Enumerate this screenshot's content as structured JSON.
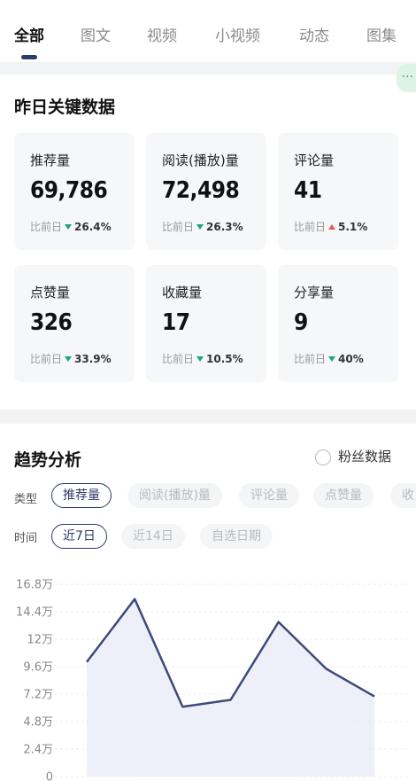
{
  "tabs": [
    "全部",
    "图文",
    "视频",
    "小视频",
    "动态",
    "图集"
  ],
  "side_handle_icon": "more-dots-icon",
  "yesterday": {
    "title": "昨日关键数据",
    "cards": [
      {
        "label": "推荐量",
        "value": "69,786",
        "cmp_label": "比前日",
        "direction": "down",
        "pct": "26.4%"
      },
      {
        "label": "阅读(播放)量",
        "value": "72,498",
        "cmp_label": "比前日",
        "direction": "down",
        "pct": "26.3%"
      },
      {
        "label": "评论量",
        "value": "41",
        "cmp_label": "比前日",
        "direction": "up",
        "pct": "5.1%"
      },
      {
        "label": "点赞量",
        "value": "326",
        "cmp_label": "比前日",
        "direction": "down",
        "pct": "33.9%"
      },
      {
        "label": "收藏量",
        "value": "17",
        "cmp_label": "比前日",
        "direction": "down",
        "pct": "10.5%"
      },
      {
        "label": "分享量",
        "value": "9",
        "cmp_label": "比前日",
        "direction": "down",
        "pct": "40%"
      }
    ]
  },
  "trend": {
    "title": "趋势分析",
    "fans_toggle_label": "粉丝数据",
    "type_label": "类型",
    "type_chips": [
      "推荐量",
      "阅读(播放)量",
      "评论量",
      "点赞量",
      "收"
    ],
    "time_label": "时间",
    "time_chips": [
      "近7日",
      "近14日",
      "自选日期"
    ]
  },
  "colors": {
    "accent": "#2d3a6b",
    "down": "#1aa874",
    "up": "#e05a5a",
    "line": "#3d4a7a",
    "fill": "#e8ebf7"
  },
  "chart_data": {
    "type": "area",
    "y_ticks": [
      "16.8万",
      "14.4万",
      "12万",
      "9.6万",
      "7.2万",
      "4.8万",
      "2.4万",
      "0"
    ],
    "ylim": [
      0,
      168000
    ],
    "series": [
      {
        "values": [
          100000,
          155000,
          61000,
          67000,
          135000,
          94000,
          70000
        ]
      }
    ]
  }
}
